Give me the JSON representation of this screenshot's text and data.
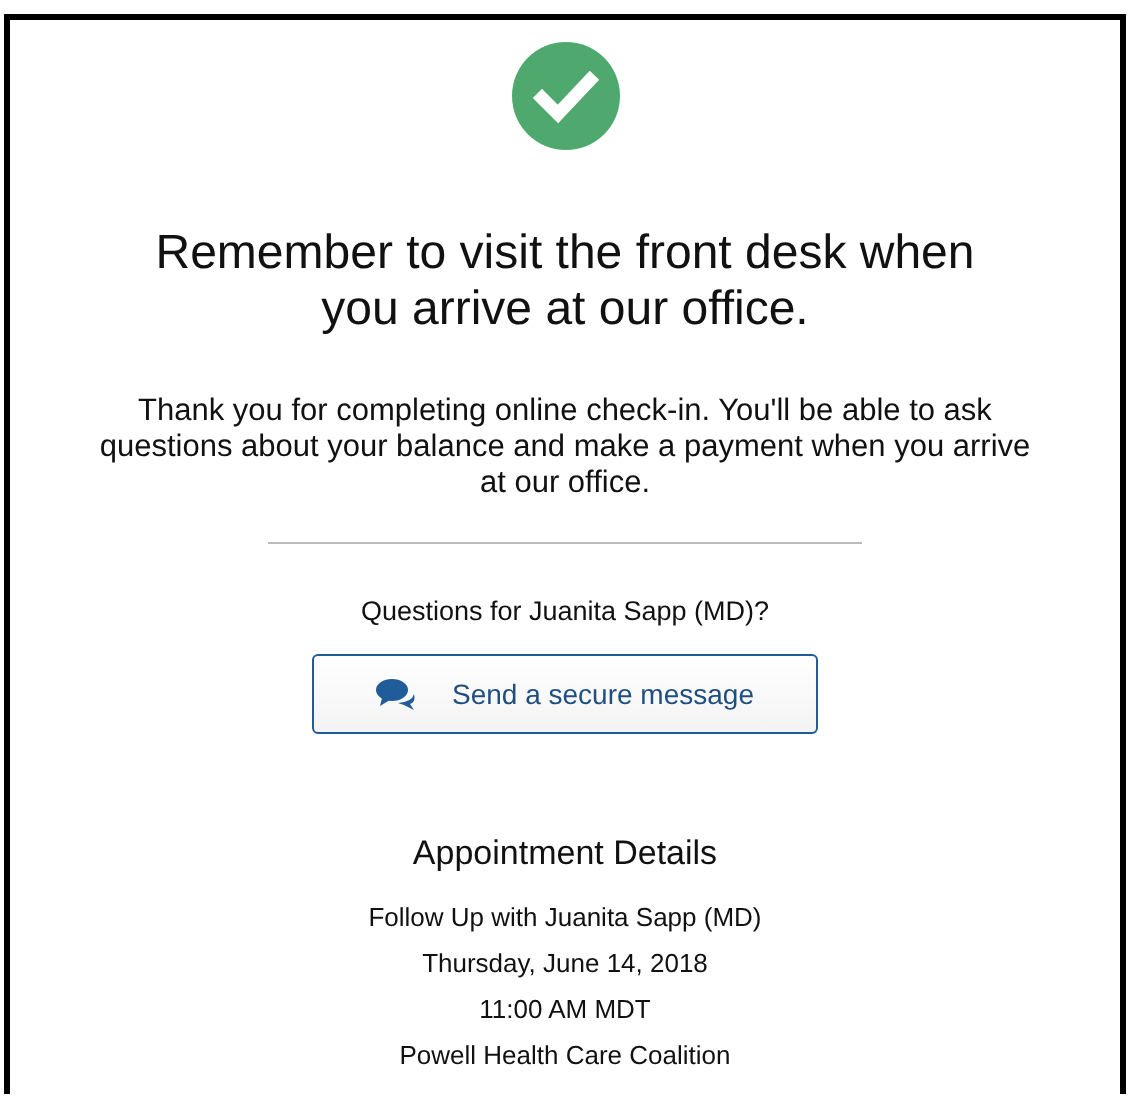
{
  "heading": "Remember to visit the front desk when you arrive at our office.",
  "message": "Thank you for completing online check-in. You'll be able to ask questions about your balance and make a payment when you arrive at our office.",
  "questions": "Questions for Juanita Sapp (MD)?",
  "button": "Send a secure message",
  "details": {
    "title": "Appointment Details",
    "lines": [
      "Follow Up with Juanita Sapp (MD)",
      "Thursday, June 14, 2018",
      "11:00 AM MDT",
      "Powell Health Care Coalition"
    ]
  }
}
